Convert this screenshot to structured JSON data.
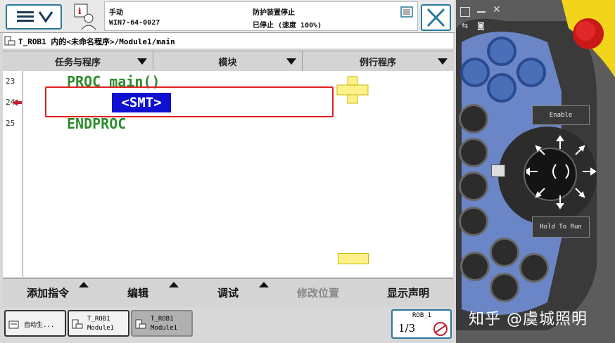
{
  "status": {
    "mode": "手动",
    "controller": "WIN7-64-0027",
    "safety": "防护装置停止",
    "state": "已停止 (速度 100%)"
  },
  "path": "T_ROB1 内的<未命名程序>/Module1/main",
  "columns": [
    "任务与程序",
    "模块",
    "例行程序"
  ],
  "code": {
    "lines": [
      {
        "num": "23",
        "text": "PROC main()"
      },
      {
        "num": "24",
        "text": ""
      },
      {
        "num": "25",
        "text": "ENDPROC"
      }
    ],
    "placeholder": "<SMT>"
  },
  "commands": [
    "添加指令",
    "编辑",
    "调试",
    "修改位置",
    "显示声明"
  ],
  "tasks": [
    {
      "line1": "自动生...",
      "line2": ""
    },
    {
      "line1": "T_ROB1",
      "line2": "Module1"
    },
    {
      "line1": "T_ROB1",
      "line2": "Module1"
    }
  ],
  "rob_status": {
    "name": "ROB_1",
    "fraction": "1/3"
  },
  "pendant": {
    "enable": "Enable",
    "hold": "Hold To Run"
  },
  "watermark": "知乎 @虞城照明",
  "colors": {
    "accent": "#2a7a9a",
    "code_green": "#2e8b2e",
    "placeholder_bg": "#1010d0",
    "highlight": "#e02020",
    "pendant_blue": "#4a6fb8"
  },
  "icons": [
    "menu-icon",
    "user-info-icon",
    "close-icon",
    "program-icon",
    "pointer-icon",
    "plus-icon",
    "minus-icon"
  ]
}
